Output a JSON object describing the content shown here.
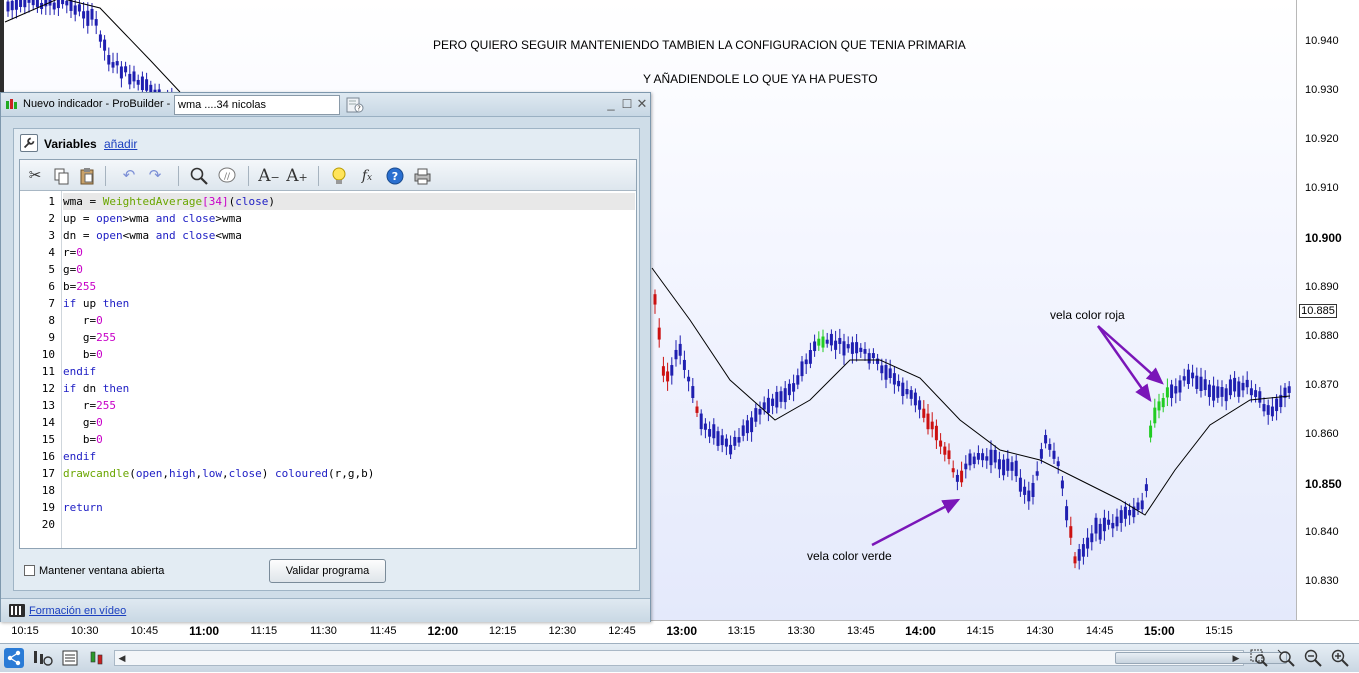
{
  "chart": {
    "note_line1": "PERO QUIERO SEGUIR MANTENIENDO TAMBIEN LA CONFIGURACION QUE TENIA PRIMARIA",
    "note_line2": "Y  AÑADIENDOLE LO QUE YA HA PUESTO",
    "annotation_red": "vela color roja",
    "annotation_green": "vela color verde",
    "current_price": "10.885",
    "price_ticks": [
      "10.940",
      "10.930",
      "10.920",
      "10.910",
      "10.900",
      "10.890",
      "10.885",
      "10.880",
      "10.870",
      "10.860",
      "10.850",
      "10.840",
      "10.830"
    ],
    "bold_price_ticks": [
      "10.900",
      "10.850"
    ],
    "time_ticks": [
      "10:15",
      "10:30",
      "10:45",
      "11:00",
      "11:15",
      "11:30",
      "11:45",
      "12:00",
      "12:15",
      "12:30",
      "12:45",
      "13:00",
      "13:15",
      "13:30",
      "13:45",
      "14:00",
      "14:15",
      "14:30",
      "14:45",
      "15:00",
      "15:15"
    ],
    "bold_time_ticks": [
      "11:00",
      "12:00",
      "13:00",
      "14:00",
      "15:00"
    ],
    "colors": {
      "bull": "#1f1fb0",
      "up_candle": "#22cc22",
      "down_candle": "#cc1111",
      "wma": "#000000",
      "arrow": "#7a16b8"
    }
  },
  "pb": {
    "title": "Nuevo indicador - ProBuilder  -",
    "name_value": "wma ....34 nicolas",
    "variables_label": "Variables",
    "add_link": "añadir",
    "keep_open_label": "Mantener ventana abierta",
    "validate_label": "Validar programa",
    "video_link": "Formación en vídeo",
    "toolbar_icons": [
      "cut-icon",
      "copy-icon",
      "paste-icon",
      "undo-icon",
      "redo-icon",
      "search-icon",
      "comment-icon",
      "font-decrease-icon",
      "font-increase-icon",
      "bulb-icon",
      "fx-icon",
      "help-icon",
      "print-icon"
    ],
    "code_lines": [
      "wma = WeightedAverage[34](close)",
      "up = open>wma and close>wma",
      "dn = open<wma and close<wma",
      "r=0",
      "g=0",
      "b=255",
      "if up then",
      "   r=0",
      "   g=255",
      "   b=0",
      "endif",
      "if dn then",
      "   r=255",
      "   g=0",
      "   b=0",
      "endif",
      "drawcandle(open,high,low,close) coloured(r,g,b)",
      "",
      "return",
      ""
    ]
  },
  "bottom_bar": {
    "icons": [
      "share-icon",
      "indicator-icon",
      "list-icon",
      "candles-icon",
      "zoom-fit-icon",
      "zoom-box-icon",
      "zoom-out-icon",
      "zoom-in-icon"
    ]
  }
}
